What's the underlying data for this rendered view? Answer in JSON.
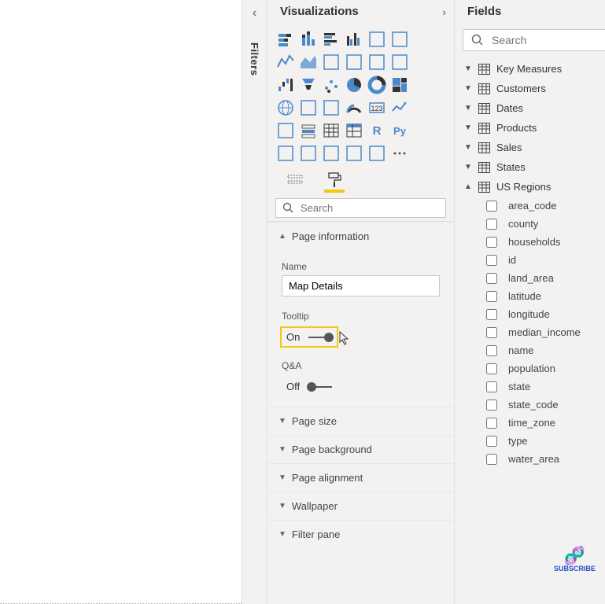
{
  "filters": {
    "label": "Filters"
  },
  "visualizations": {
    "title": "Visualizations",
    "search_placeholder": "Search",
    "sections": {
      "page_info": {
        "label": "Page information",
        "expanded": true
      },
      "page_size": {
        "label": "Page size",
        "expanded": false
      },
      "page_bg": {
        "label": "Page background",
        "expanded": false
      },
      "page_align": {
        "label": "Page alignment",
        "expanded": false
      },
      "wallpaper": {
        "label": "Wallpaper",
        "expanded": false
      },
      "filter_pane": {
        "label": "Filter pane",
        "expanded": false
      }
    },
    "page_info": {
      "name_label": "Name",
      "name_value": "Map Details",
      "tooltip_label": "Tooltip",
      "tooltip_state": "On",
      "qa_label": "Q&A",
      "qa_state": "Off"
    },
    "viz_icons": [
      "stacked-bar",
      "stacked-column",
      "clustered-bar",
      "clustered-column",
      "stacked-bar-100",
      "stacked-column-100",
      "line",
      "area",
      "stacked-area",
      "line-clustered",
      "line-stacked",
      "ribbon",
      "waterfall",
      "funnel",
      "scatter",
      "pie",
      "donut",
      "treemap",
      "map",
      "filled-map",
      "shape-map",
      "gauge",
      "card",
      "kpi",
      "multi-card",
      "slicer",
      "table",
      "matrix",
      "r-script",
      "python",
      "key-influencers",
      "decomposition",
      "qa-visual",
      "paginated",
      "power-apps",
      "more"
    ]
  },
  "fields": {
    "title": "Fields",
    "search_placeholder": "Search",
    "tables": [
      {
        "name": "Key Measures",
        "expanded": false
      },
      {
        "name": "Customers",
        "expanded": false
      },
      {
        "name": "Dates",
        "expanded": false
      },
      {
        "name": "Products",
        "expanded": false
      },
      {
        "name": "Sales",
        "expanded": false
      },
      {
        "name": "States",
        "expanded": false
      },
      {
        "name": "US Regions",
        "expanded": true,
        "fields": [
          "area_code",
          "county",
          "households",
          "id",
          "land_area",
          "latitude",
          "longitude",
          "median_income",
          "name",
          "population",
          "state",
          "state_code",
          "time_zone",
          "type",
          "water_area"
        ]
      }
    ]
  },
  "subscribe": {
    "label": "SUBSCRIBE"
  }
}
